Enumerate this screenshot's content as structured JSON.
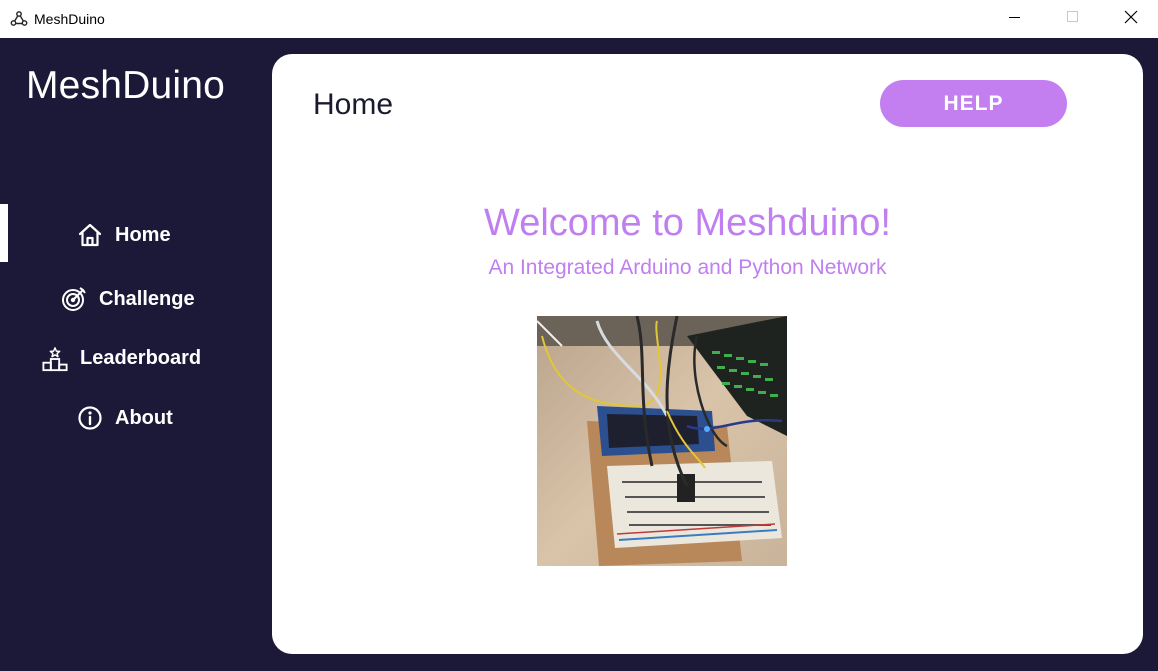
{
  "window": {
    "title": "MeshDuino",
    "minimize_icon": "minimize-icon",
    "maximize_icon": "maximize-icon",
    "close_icon": "close-icon"
  },
  "sidebar": {
    "brand": "MeshDuino",
    "items": [
      {
        "label": "Home",
        "icon": "home-icon",
        "active": true
      },
      {
        "label": "Challenge",
        "icon": "target-icon",
        "active": false
      },
      {
        "label": "Leaderboard",
        "icon": "podium-icon",
        "active": false
      },
      {
        "label": "About",
        "icon": "info-icon",
        "active": false
      }
    ]
  },
  "main": {
    "page_title": "Home",
    "help_label": "HELP",
    "welcome": "Welcome to Meshduino!",
    "subtitle": "An Integrated Arduino and Python Network",
    "image_name": "arduino-breadboard-photo"
  },
  "colors": {
    "sidebar_bg": "#1c1838",
    "accent": "#c37ff0",
    "card_bg": "#ffffff"
  }
}
